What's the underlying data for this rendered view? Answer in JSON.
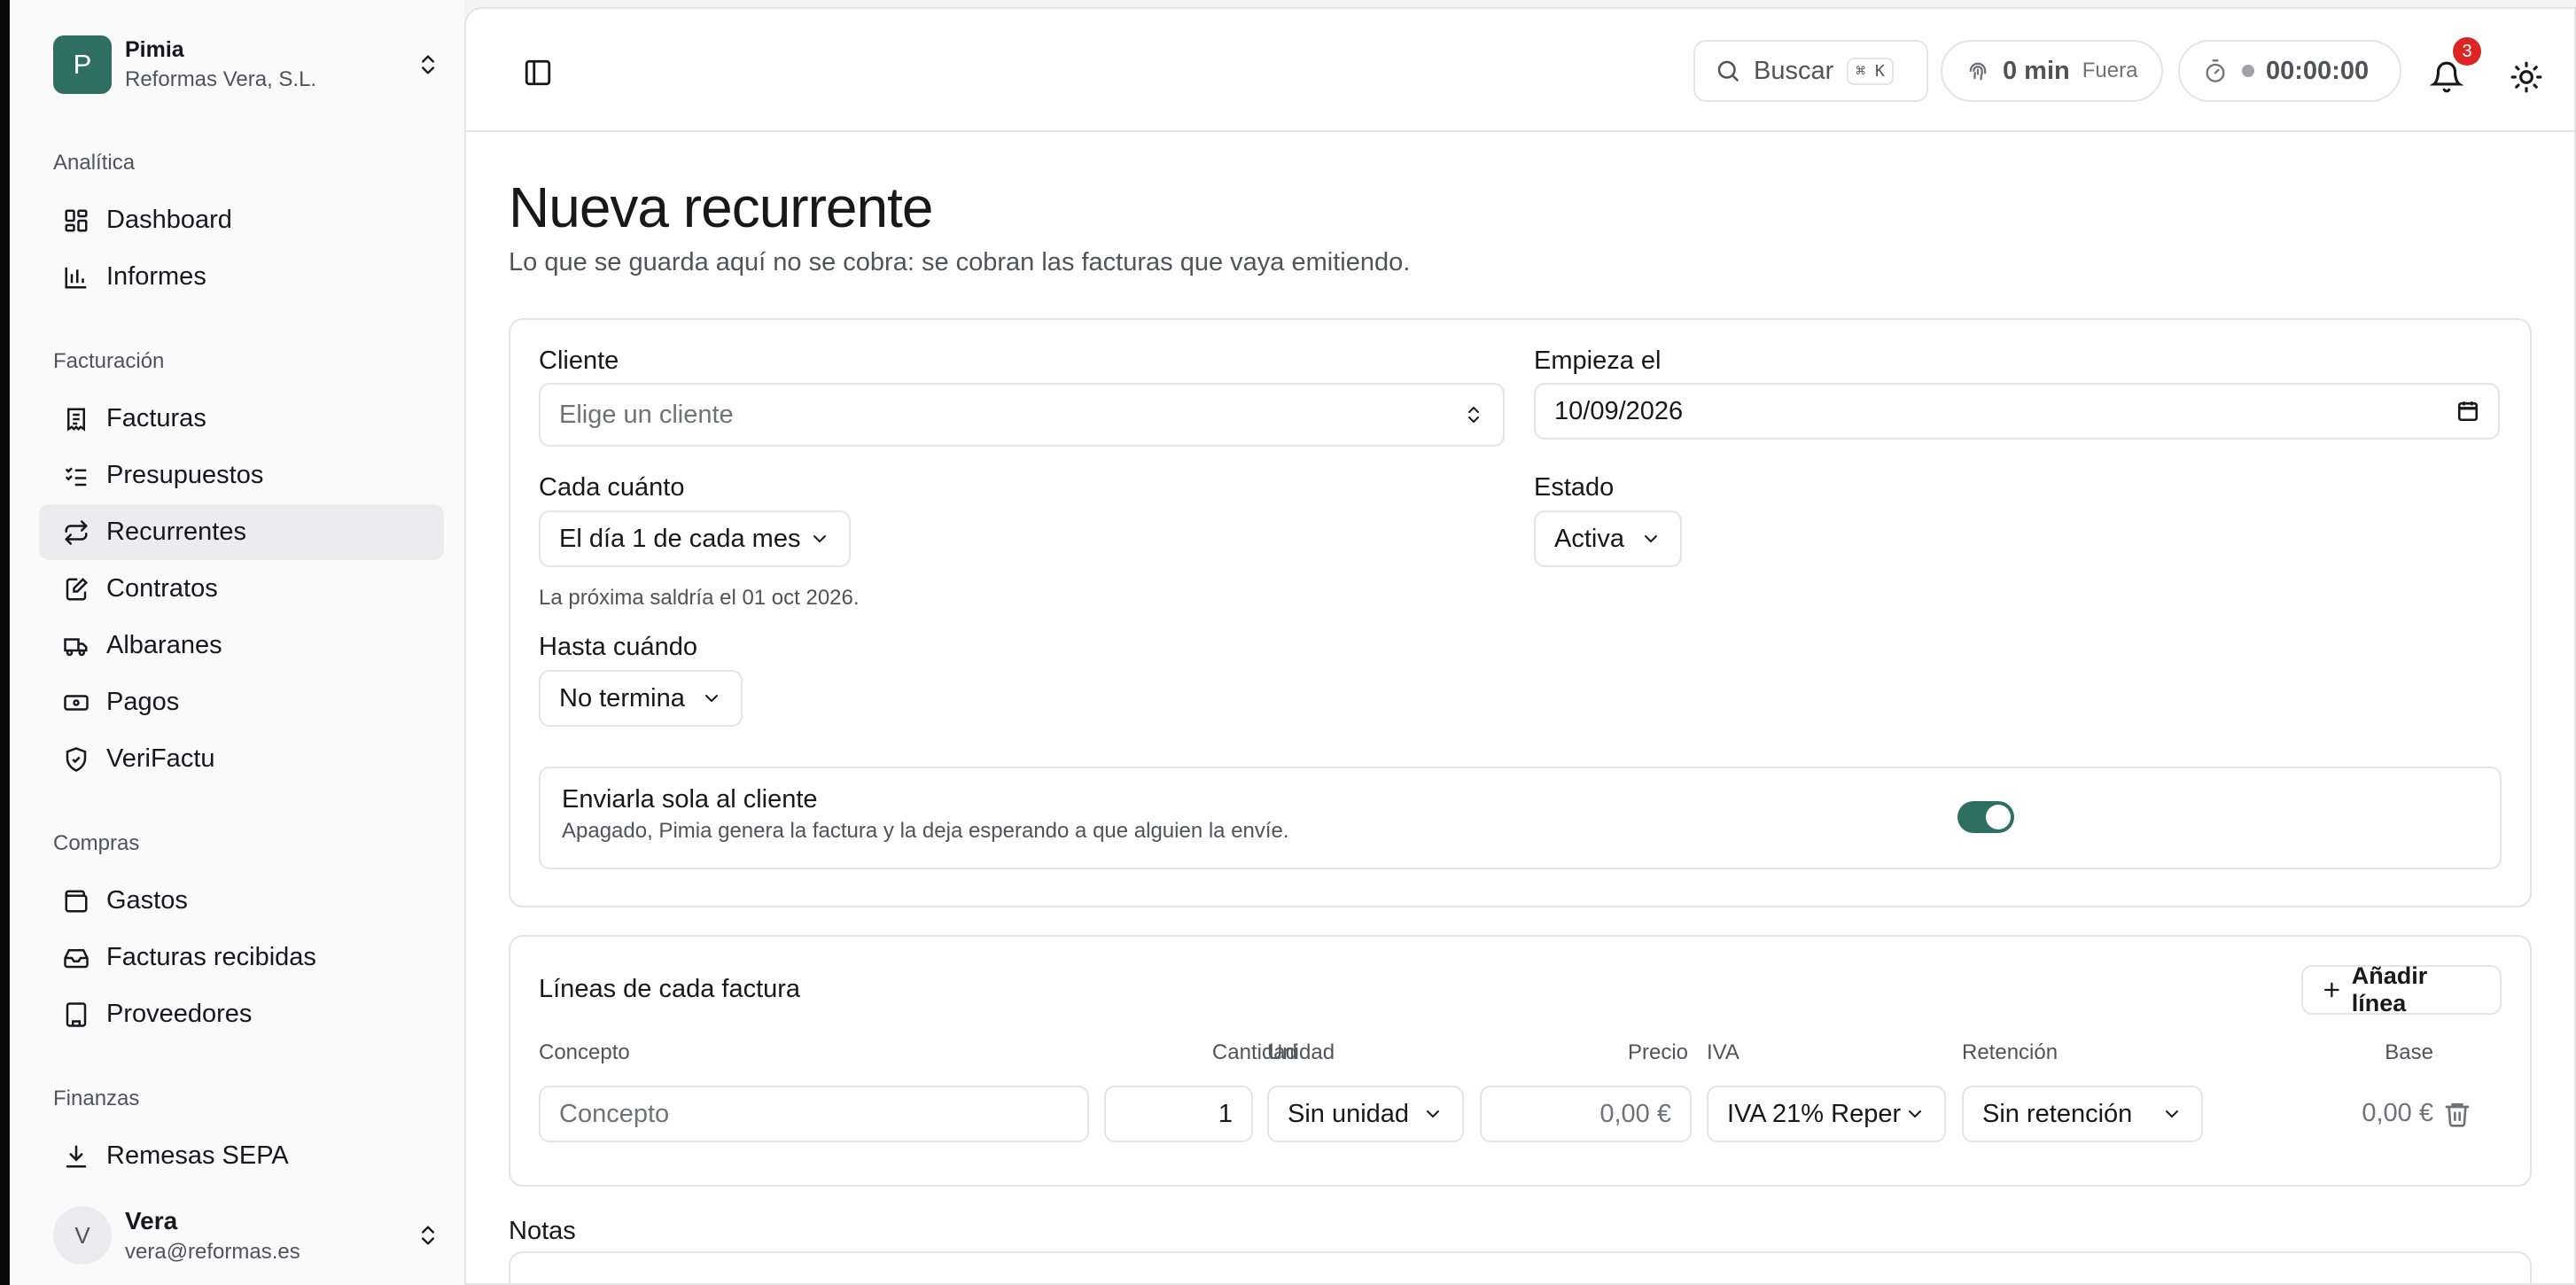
{
  "workspace": {
    "initial": "P",
    "name": "Pimia",
    "company": "Reformas Vera, S.L."
  },
  "sidebar": {
    "sections": [
      {
        "label": "Analítica",
        "items": [
          {
            "label": "Dashboard",
            "icon": "dashboard-icon"
          },
          {
            "label": "Informes",
            "icon": "bar-chart-icon"
          }
        ]
      },
      {
        "label": "Facturación",
        "items": [
          {
            "label": "Facturas",
            "icon": "invoice-icon"
          },
          {
            "label": "Presupuestos",
            "icon": "checklist-icon"
          },
          {
            "label": "Recurrentes",
            "icon": "repeat-icon",
            "active": true
          },
          {
            "label": "Contratos",
            "icon": "contract-edit-icon"
          },
          {
            "label": "Albaranes",
            "icon": "truck-icon"
          },
          {
            "label": "Pagos",
            "icon": "banknote-icon"
          },
          {
            "label": "VeriFactu",
            "icon": "shield-check-icon"
          }
        ]
      },
      {
        "label": "Compras",
        "items": [
          {
            "label": "Gastos",
            "icon": "wallet-icon"
          },
          {
            "label": "Facturas recibidas",
            "icon": "inbox-icon"
          },
          {
            "label": "Proveedores",
            "icon": "building-icon"
          }
        ]
      },
      {
        "label": "Finanzas",
        "items": [
          {
            "label": "Remesas SEPA",
            "icon": "download-icon"
          }
        ]
      }
    ]
  },
  "user": {
    "initial": "V",
    "name": "Vera",
    "email": "vera@reformas.es"
  },
  "topbar": {
    "search_label": "Buscar",
    "search_shortcut": "⌘ K",
    "clock_time": "0 min",
    "clock_status": "Fuera",
    "timer": "00:00:00",
    "notifications_count": "3"
  },
  "page": {
    "title": "Nueva recurrente",
    "subtitle": "Lo que se guarda aquí no se cobra: se cobran las facturas que vaya emitiendo."
  },
  "form": {
    "client_label": "Cliente",
    "client_placeholder": "Elige un cliente",
    "start_label": "Empieza el",
    "start_value": "10/09/2026",
    "frequency_label": "Cada cuánto",
    "frequency_value": "El día 1 de cada mes",
    "next_hint": "La próxima saldría el 01 oct 2026.",
    "status_label": "Estado",
    "status_value": "Activa",
    "until_label": "Hasta cuándo",
    "until_value": "No termina",
    "send_title": "Enviarla sola al cliente",
    "send_desc": "Apagado, Pimia genera la factura y la deja esperando a que alguien la envíe.",
    "send_enabled": true
  },
  "lines": {
    "title": "Líneas de cada factura",
    "add_label": "Añadir línea",
    "columns": [
      "Concepto",
      "Cantidad",
      "Unidad",
      "Precio",
      "IVA",
      "Retención",
      "Base"
    ],
    "row": {
      "concept_placeholder": "Concepto",
      "quantity": "1",
      "unit": "Sin unidad",
      "price_placeholder": "0,00 €",
      "vat": "IVA 21% Reper",
      "retention": "Sin retención",
      "base": "0,00 €"
    }
  },
  "notes_label": "Notas",
  "colors": {
    "accent": "#2f6f63",
    "badge": "#dc2626"
  }
}
